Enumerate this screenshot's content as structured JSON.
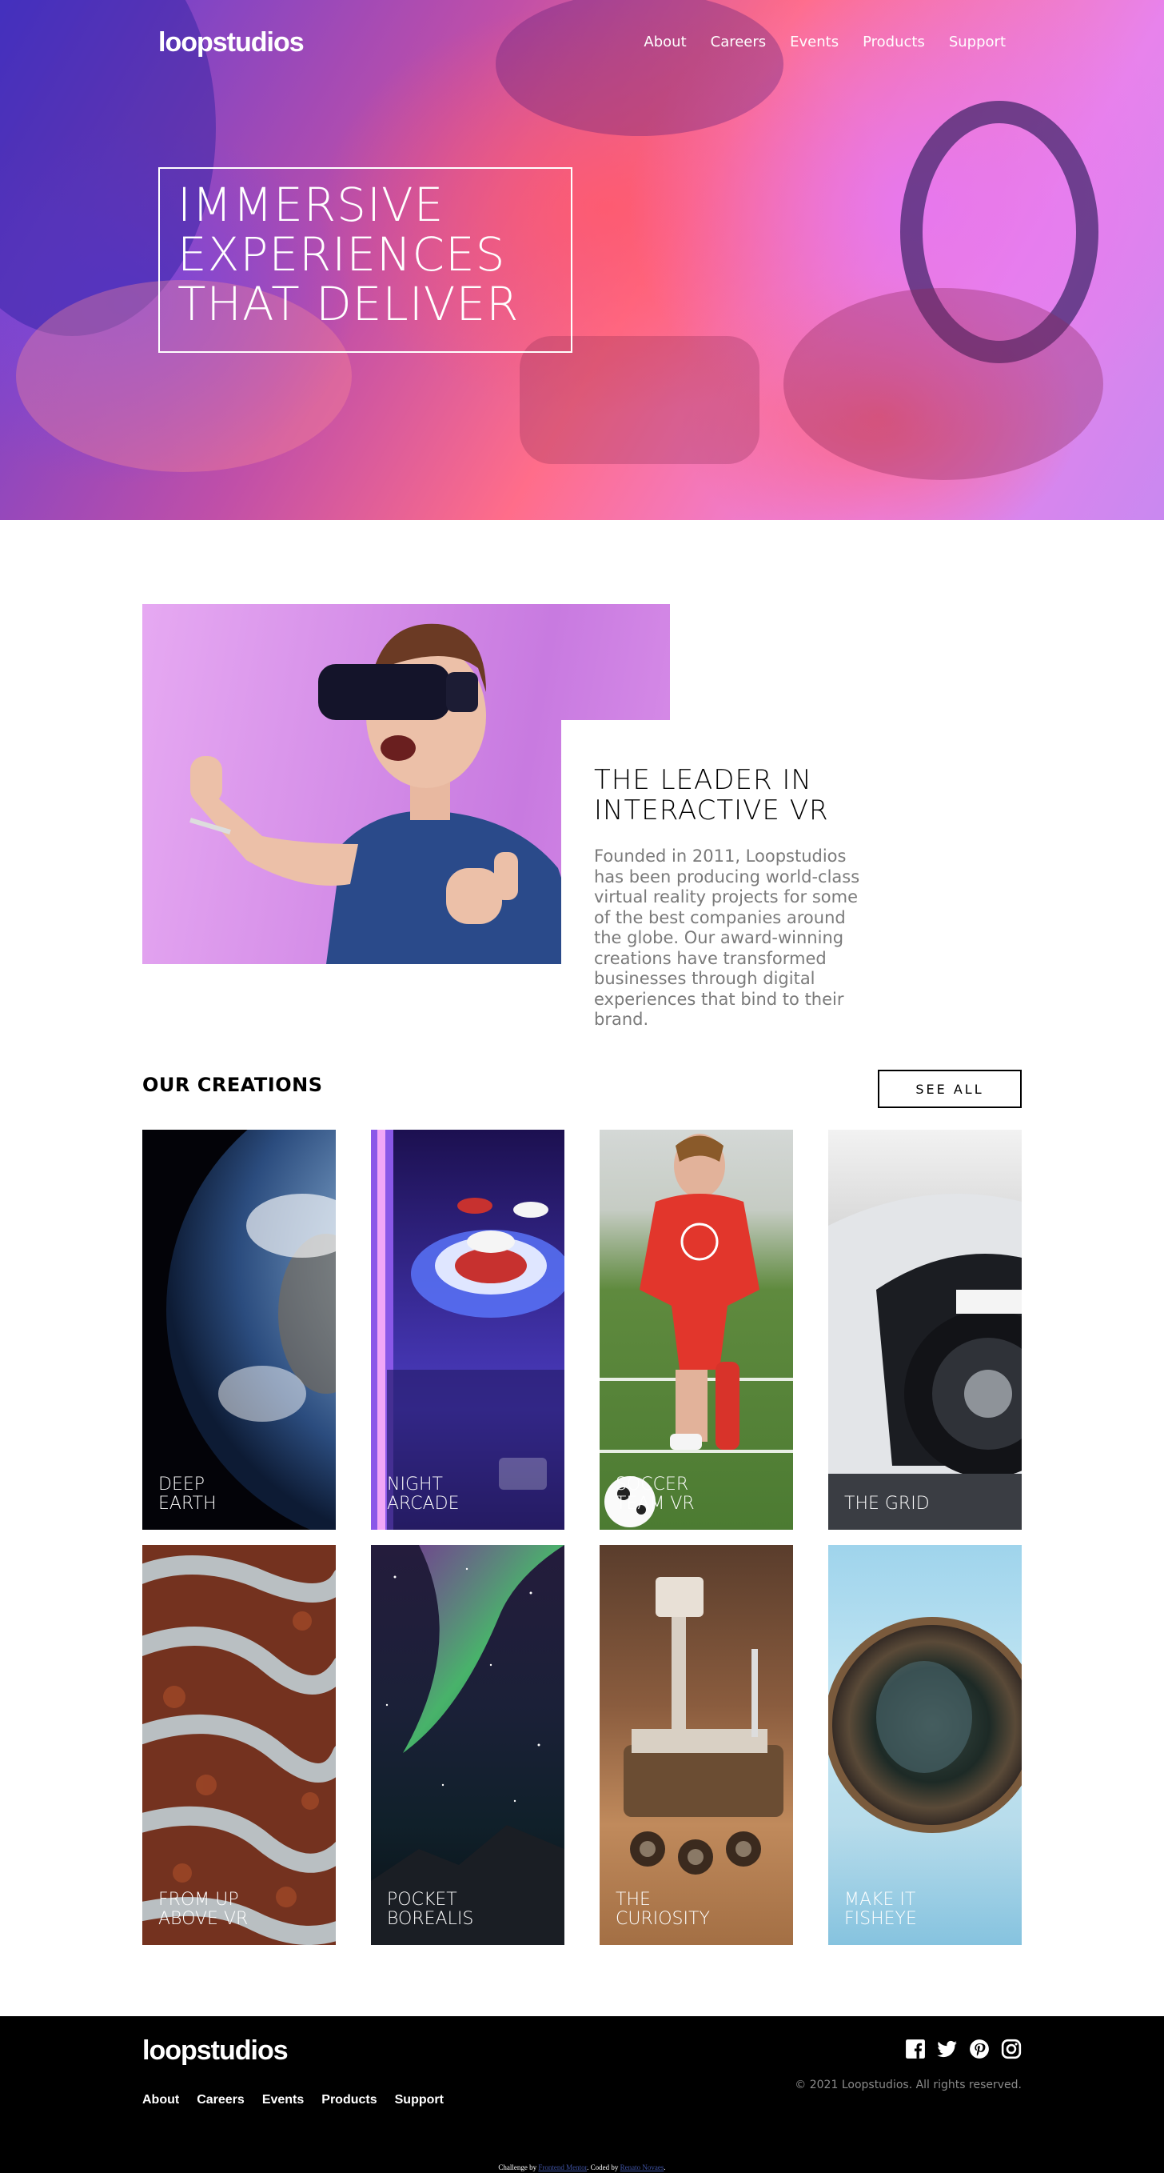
{
  "brand": {
    "logo": "loopstudios"
  },
  "nav": {
    "items": [
      "About",
      "Careers",
      "Events",
      "Products",
      "Support"
    ]
  },
  "hero": {
    "title": "IMMERSIVE\nEXPERIENCES\nTHAT DELIVER"
  },
  "about": {
    "title": "THE LEADER IN\nINTERACTIVE VR",
    "text": "Founded in 2011, Loopstudios has been producing world-class virtual reality projects for some of the best companies around the globe. Our award-winning creations have transformed businesses through digital experiences that bind to their brand."
  },
  "creations": {
    "title": "OUR CREATIONS",
    "see_all": "SEE ALL",
    "items": [
      {
        "label": "DEEP\nEARTH"
      },
      {
        "label": "NIGHT\nARCADE"
      },
      {
        "label": "SOCCER\nTEAM VR"
      },
      {
        "label": "THE GRID"
      },
      {
        "label": "FROM UP\nABOVE VR"
      },
      {
        "label": "POCKET\nBOREALIS"
      },
      {
        "label": "THE\nCURIOSITY"
      },
      {
        "label": "MAKE IT\nFISHEYE"
      }
    ]
  },
  "footer": {
    "logo": "loopstudios",
    "nav": [
      "About",
      "Careers",
      "Events",
      "Products",
      "Support"
    ],
    "socials": [
      "facebook-icon",
      "twitter-icon",
      "pinterest-icon",
      "instagram-icon"
    ],
    "copyright": "© 2021 Loopstudios. All rights reserved.",
    "attribution": {
      "prefix": "Challenge by ",
      "challenge_link": "Frontend Mentor",
      "middle": ". Coded by ",
      "author_link": "Renato Novaes",
      "suffix": "."
    }
  }
}
